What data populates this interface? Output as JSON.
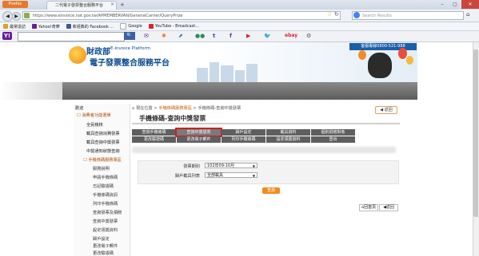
{
  "browser": {
    "app_button": "Firefox",
    "tab_title": "二代電子發票整合服務平台",
    "url": "https://www.einvoice.nat.gov.tw/APMEMBERVAN/GeneralCarrier/QueryPrize",
    "search_placeholder": "Search Results"
  },
  "bookmarks": [
    "最常造訪",
    "Yahoo!奇摩",
    "新經典的 Facebook ...",
    "Google",
    "YouTube - Broadcast..."
  ],
  "site": {
    "mof": "財政部",
    "mof_en": "E-invoice Platform",
    "title": "電子發票整合服務平台",
    "hotline": "客服專線0800-521-988"
  },
  "sidebar": {
    "top": "歡迎",
    "group1": "消費者功能選單",
    "items1": [
      "全民稽核",
      "載具查詢消費發票",
      "載具查詢中獎發票",
      "中獎通知狀態查詢"
    ],
    "group2": "手機條碼服務專區",
    "items2": [
      "服務說明",
      "申請手機條碼",
      "忘記驗證碼",
      "手機條碼資訊",
      "列印手機條碼",
      "查詢發票及捐贈",
      "查詢中獎發票",
      "設定領獎資料",
      "歸戶設定",
      "更改電子郵件",
      "更改驗證碼"
    ]
  },
  "breadcrumb": {
    "home": "現在位置",
    "link": "手機條碼服務專區",
    "rest": "手機條碼-查詢中獎發票"
  },
  "back_label": "返回",
  "page_title": "手機條碼-查詢中獎發票",
  "tabs": [
    [
      "查詢手機條碼",
      "查詢中獎發票",
      "歸戶設定",
      "載具資料",
      "個別捐贈對象"
    ],
    [
      "更改驗證碼",
      "更改電子郵件",
      "列印手機條碼",
      "設定領獎資料",
      "登出"
    ]
  ],
  "form": {
    "period_label": "發票期別",
    "period_value": "102年09-10月",
    "carrier_label": "歸戶載具列表",
    "carrier_value": "全部載具",
    "query": "查詢"
  },
  "footer": {
    "home": "回首頁",
    "back": "返回"
  }
}
